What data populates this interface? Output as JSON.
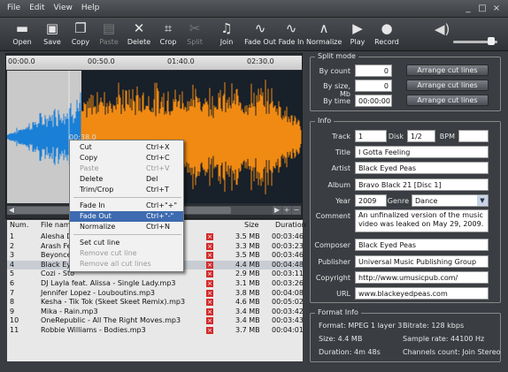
{
  "menu": [
    "File",
    "Edit",
    "View",
    "Help"
  ],
  "window_buttons": [
    "_",
    "□",
    "×"
  ],
  "toolbar": [
    {
      "label": "Open",
      "icon": "folder-icon",
      "glyph": "▬",
      "enabled": true
    },
    {
      "label": "Save",
      "icon": "save-icon",
      "glyph": "▣",
      "enabled": true
    },
    {
      "label": "Copy",
      "icon": "copy-icon",
      "glyph": "❐",
      "enabled": true
    },
    {
      "label": "Paste",
      "icon": "paste-icon",
      "glyph": "▤",
      "enabled": false
    },
    {
      "label": "Delete",
      "icon": "delete-icon",
      "glyph": "✕",
      "enabled": true
    },
    {
      "label": "Crop",
      "icon": "crop-icon",
      "glyph": "⌗",
      "enabled": true
    },
    {
      "label": "Split",
      "icon": "split-icon",
      "glyph": "✂",
      "enabled": false
    },
    {
      "label": "Join",
      "icon": "join-icon",
      "glyph": "♫",
      "enabled": true
    },
    {
      "label": "Fade Out",
      "icon": "fade-out-icon",
      "glyph": "∿",
      "enabled": true
    },
    {
      "label": "Fade In",
      "icon": "fade-in-icon",
      "glyph": "∿",
      "enabled": true
    },
    {
      "label": "Normalize",
      "icon": "normalize-icon",
      "glyph": "∧",
      "enabled": true
    },
    {
      "label": "Play",
      "icon": "play-icon",
      "glyph": "▶",
      "enabled": true
    },
    {
      "label": "Record",
      "icon": "record-icon",
      "glyph": "●",
      "enabled": true
    }
  ],
  "volume_icon": "speaker-icon",
  "volume_level": 0.8,
  "ruler_ticks": [
    "00:00.0",
    "00:50.0",
    "01:40.0",
    "02:30.0"
  ],
  "cursor_time": "00:38.0",
  "list_headers": {
    "num": "Num.",
    "file": "File name",
    "size": "Size",
    "duration": "Duration"
  },
  "files": [
    {
      "num": "1",
      "name": "Alesha D",
      "size": "3.5 MB",
      "duration": "00:03:46"
    },
    {
      "num": "2",
      "name": "Arash Fe",
      "size": "3.3 MB",
      "duration": "00:03:23"
    },
    {
      "num": "3",
      "name": "Beyonce",
      "size": "3.5 MB",
      "duration": "00:03:46"
    },
    {
      "num": "4",
      "name": "Black Eye",
      "size": "4.4 MB",
      "duration": "00:04:48"
    },
    {
      "num": "5",
      "name": "Cozi - Sto",
      "size": "2.9 MB",
      "duration": "00:03:11"
    },
    {
      "num": "6",
      "name": "DJ Layla feat. Alissa - Single Lady.mp3",
      "size": "3.1 MB",
      "duration": "00:03:26"
    },
    {
      "num": "7",
      "name": "Jennifer Lopez - Louboutins.mp3",
      "size": "3.8 MB",
      "duration": "00:04:08"
    },
    {
      "num": "8",
      "name": "Kesha - Tik Tok (Skeet Skeet Remix).mp3",
      "size": "4.6 MB",
      "duration": "00:05:02"
    },
    {
      "num": "9",
      "name": "Mika - Rain.mp3",
      "size": "3.4 MB",
      "duration": "00:03:42"
    },
    {
      "num": "10",
      "name": "OneRepublic - All The Right Moves.mp3",
      "size": "3.4 MB",
      "duration": "00:03:43"
    },
    {
      "num": "11",
      "name": "Robbie Williams - Bodies.mp3",
      "size": "3.7 MB",
      "duration": "00:04:01"
    }
  ],
  "context_menu": [
    {
      "label": "Cut",
      "shortcut": "Ctrl+X",
      "enabled": true
    },
    {
      "label": "Copy",
      "shortcut": "Ctrl+C",
      "enabled": true
    },
    {
      "label": "Paste",
      "shortcut": "Ctrl+V",
      "enabled": false
    },
    {
      "label": "Delete",
      "shortcut": "Del",
      "enabled": true
    },
    {
      "label": "Trim/Crop",
      "shortcut": "Ctrl+T",
      "enabled": true
    },
    {
      "label": "Fade In",
      "shortcut": "Ctrl+\"+\"",
      "enabled": true
    },
    {
      "label": "Fade Out",
      "shortcut": "Ctrl+\"-\"",
      "enabled": true,
      "highlight": true
    },
    {
      "label": "Normalize",
      "shortcut": "Ctrl+N",
      "enabled": true
    },
    {
      "label": "Set cut line",
      "shortcut": "",
      "enabled": true
    },
    {
      "label": "Remove cut line",
      "shortcut": "",
      "enabled": false
    },
    {
      "label": "Remove all cut lines",
      "shortcut": "",
      "enabled": false
    }
  ],
  "split": {
    "title": "Split mode",
    "rows": [
      {
        "label": "By count",
        "value": "0",
        "button": "Arrange cut lines"
      },
      {
        "label": "By size, Mb",
        "value": "0",
        "button": "Arrange cut lines"
      },
      {
        "label": "By time",
        "value": "00:00:00",
        "button": "Arrange cut lines"
      }
    ]
  },
  "info": {
    "title": "Info",
    "track_label": "Track",
    "track": "1",
    "disk_label": "Disk",
    "disk": "1/2",
    "bpm_label": "BPM",
    "bpm": "",
    "title_label": "Title",
    "title_value": "I Gotta Feeling",
    "artist_label": "Artist",
    "artist": "Black Eyed Peas",
    "album_label": "Album",
    "album": "Bravo Black 21 [Disc 1]",
    "year_label": "Year",
    "year": "2009",
    "genre_label": "Genre",
    "genre": "Dance",
    "comment_label": "Comment",
    "comment": "An unfinalized version of the music video was leaked on May 29, 2009.",
    "composer_label": "Composer",
    "composer": "Black Eyed Peas",
    "publisher_label": "Publisher",
    "publisher": "Universal Music Publishing Group",
    "copyright_label": "Copyright",
    "copyright": "http://www.umusicpub.com/",
    "url_label": "URL",
    "url": "www.blackeyedpeas.com"
  },
  "format": {
    "title": "Format Info",
    "format": "Format: MPEG 1 layer 3",
    "bitrate": "Bitrate: 128 kbps",
    "size": "Size: 4.4 MB",
    "sample_rate": "Sample rate: 44100 Hz",
    "duration": "Duration: 4m 48s",
    "channels": "Channels count: Join Stereo"
  },
  "colors": {
    "wave_blue": "#1a7fd6",
    "wave_orange": "#f08a12",
    "selection": "#c9c9c9",
    "highlight": "#3d6ab0"
  }
}
